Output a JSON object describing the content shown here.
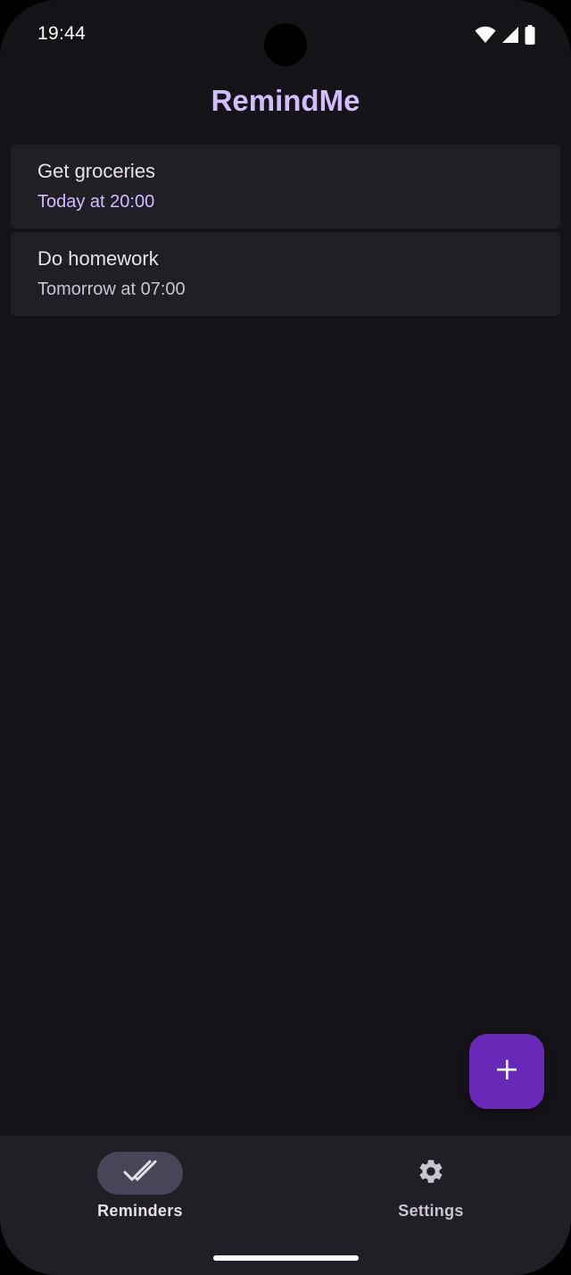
{
  "status_bar": {
    "time": "19:44",
    "icons": [
      "wifi-icon",
      "signal-icon",
      "battery-icon"
    ]
  },
  "app": {
    "title": "RemindMe"
  },
  "reminders": [
    {
      "title": "Get groceries",
      "time": "Today at 20:00",
      "highlight": true
    },
    {
      "title": "Do homework",
      "time": "Tomorrow at 07:00",
      "highlight": false
    }
  ],
  "fab": {
    "icon": "plus-icon"
  },
  "nav": {
    "items": [
      {
        "label": "Reminders",
        "icon": "double-check-icon",
        "active": true
      },
      {
        "label": "Settings",
        "icon": "gear-icon",
        "active": false
      }
    ]
  },
  "colors": {
    "background": "#151218",
    "surface": "#211f26",
    "accent": "#d0bcff",
    "fab": "#6929b8",
    "nav_indicator": "#4a4458"
  }
}
